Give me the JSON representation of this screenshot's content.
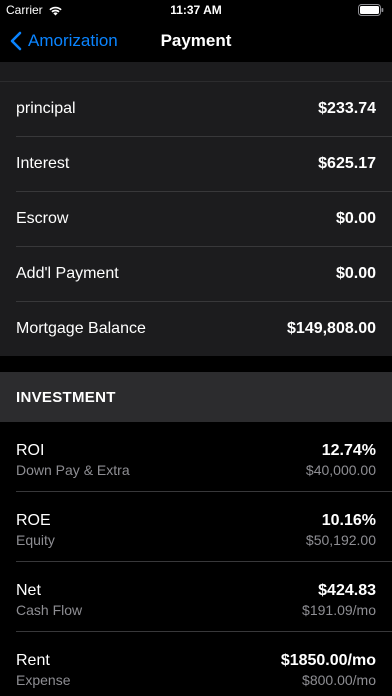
{
  "status_bar": {
    "carrier": "Carrier",
    "time": "11:37 AM"
  },
  "nav": {
    "back_label": "Amorization",
    "title": "Payment"
  },
  "payment_rows": [
    {
      "label": "principal",
      "value": "$233.74"
    },
    {
      "label": "Interest",
      "value": "$625.17"
    },
    {
      "label": "Escrow",
      "value": "$0.00"
    },
    {
      "label": "Add'l Payment",
      "value": "$0.00"
    },
    {
      "label": "Mortgage Balance",
      "value": "$149,808.00"
    }
  ],
  "investment": {
    "header": "INVESTMENT",
    "rows": [
      {
        "title": "ROI",
        "subtitle": "Down Pay & Extra",
        "value": "12.74%",
        "subvalue": "$40,000.00"
      },
      {
        "title": "ROE",
        "subtitle": "Equity",
        "value": "10.16%",
        "subvalue": "$50,192.00"
      },
      {
        "title": "Net",
        "subtitle": "Cash Flow",
        "value": "$424.83",
        "subvalue": "$191.09/mo"
      },
      {
        "title": "Rent",
        "subtitle": "Expense",
        "value": "$1850.00/mo",
        "subvalue": "$800.00/mo"
      }
    ]
  },
  "colors": {
    "accent": "#0a84ff",
    "background": "#000000",
    "cell": "#1c1c1e",
    "header": "#2c2c2e",
    "secondary_text": "#8e8e93"
  }
}
